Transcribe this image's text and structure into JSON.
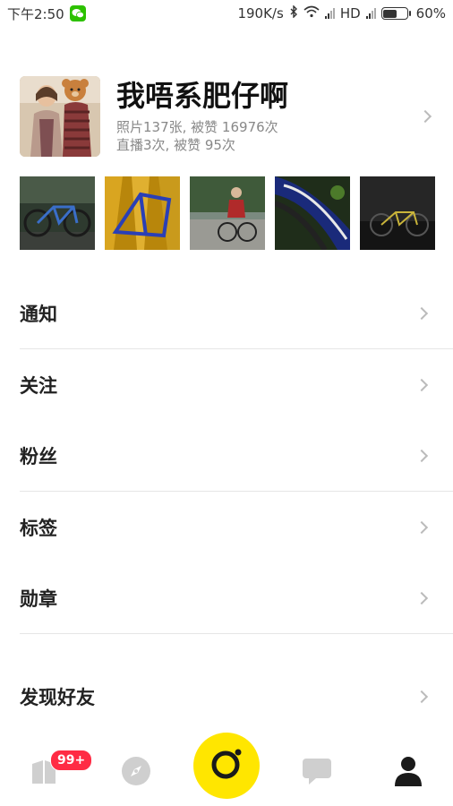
{
  "status_bar": {
    "time": "下午2:50",
    "speed": "190K/s",
    "network": "HD",
    "battery": "60%",
    "battery_level": 0.6
  },
  "profile": {
    "name": "我唔系肥仔啊",
    "photo_stats": "照片137张, 被赞 16976次",
    "live_stats": "直播3次, 被赞 95次"
  },
  "menu": [
    {
      "label": "通知"
    },
    {
      "label": "关注"
    },
    {
      "label": "粉丝"
    },
    {
      "label": "标签"
    },
    {
      "label": "勋章"
    },
    {
      "label": "发现好友"
    }
  ],
  "bottom_nav": {
    "badge": "99+",
    "items": [
      {
        "icon": "feed-icon"
      },
      {
        "icon": "compass-icon"
      },
      {
        "icon": "camera-icon"
      },
      {
        "icon": "message-icon"
      },
      {
        "icon": "person-icon"
      }
    ]
  },
  "colors": {
    "accent": "#ffe600",
    "badge": "#ff2b44",
    "text": "#222222",
    "subtle": "#888888"
  }
}
